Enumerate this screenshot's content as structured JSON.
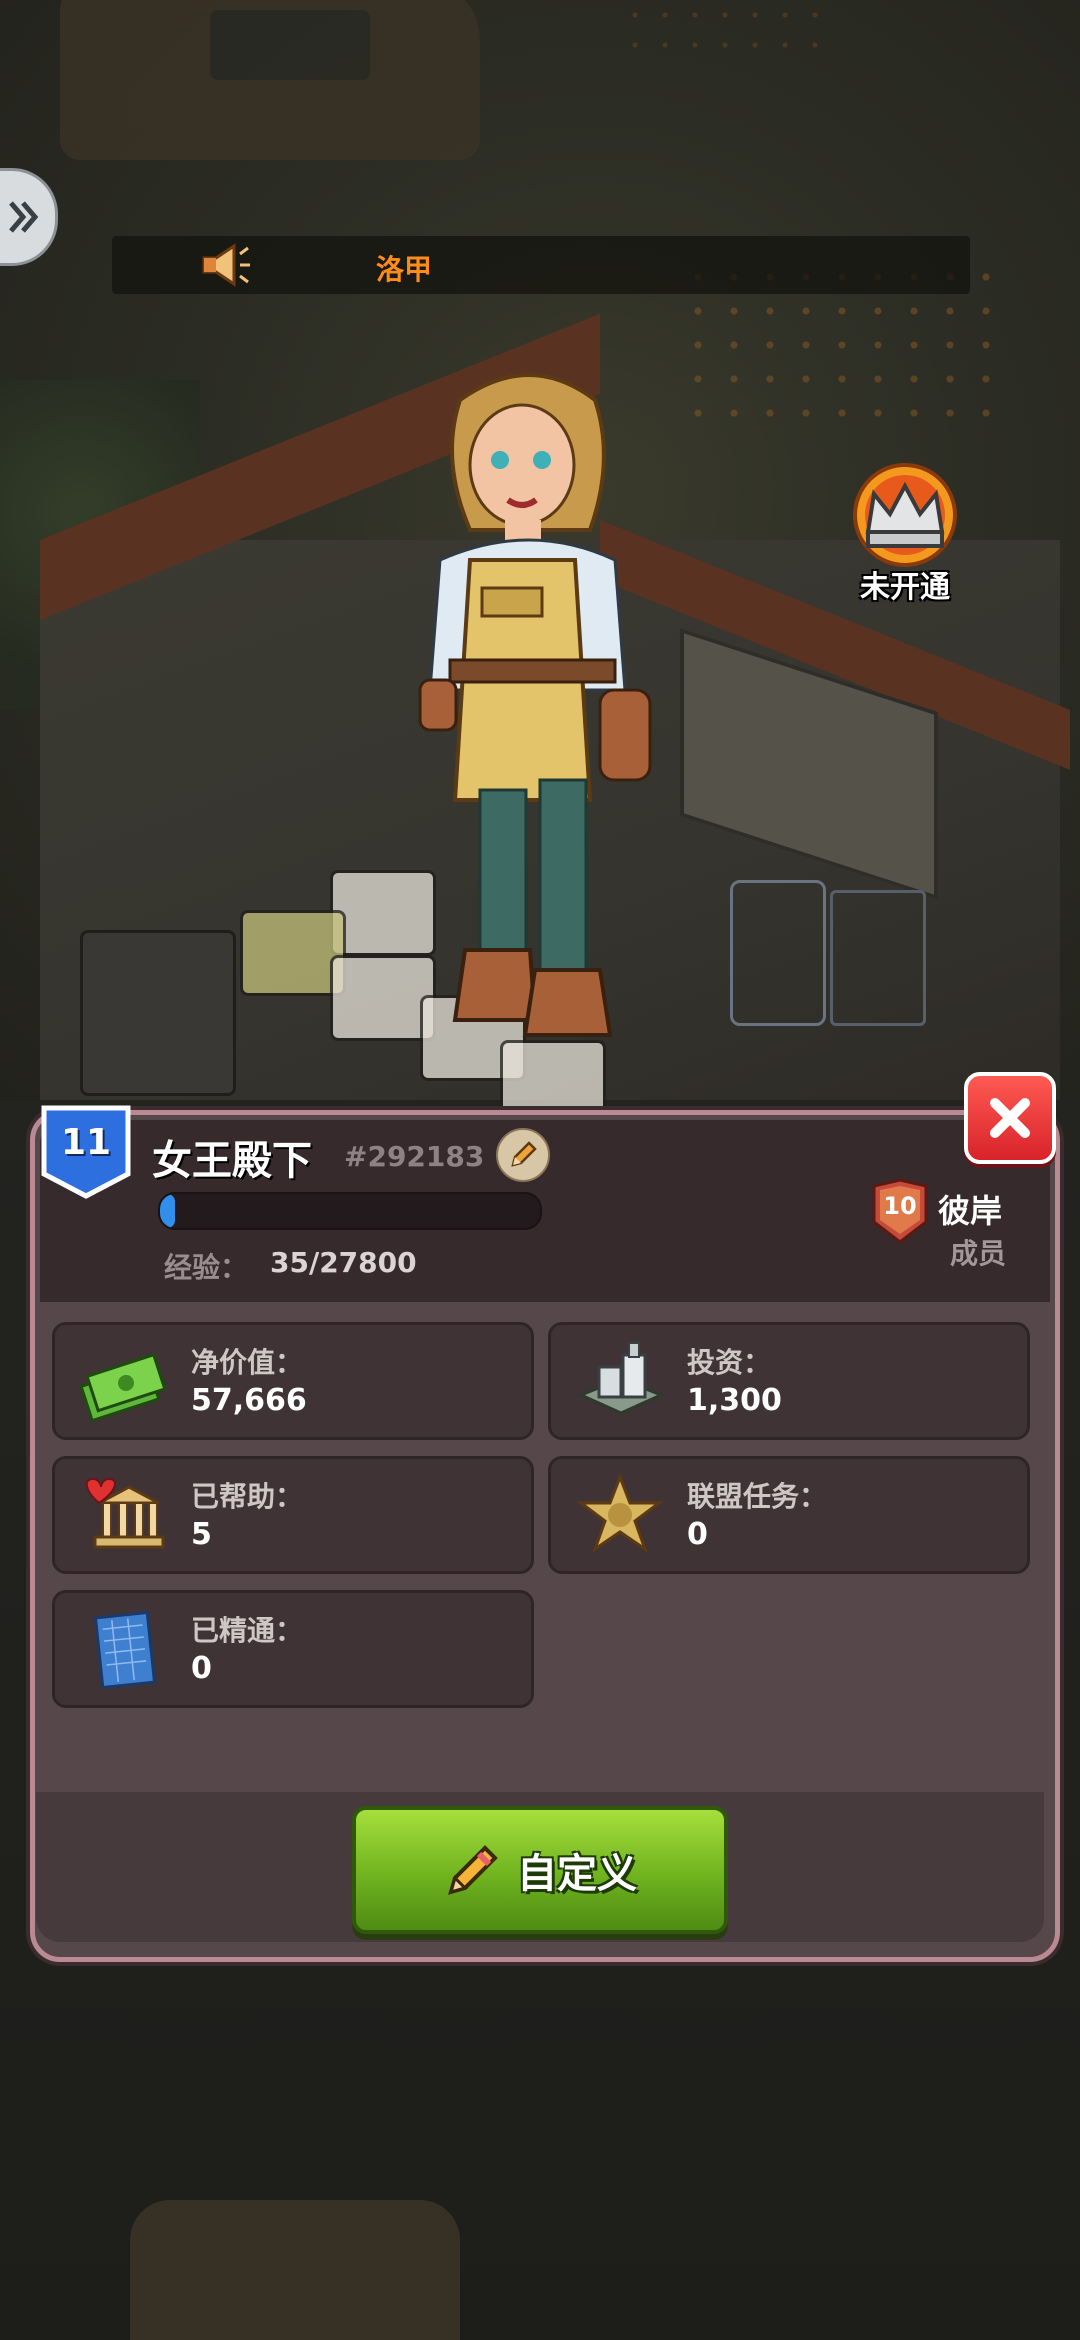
{
  "announcement": {
    "speaker_name": "洛甲"
  },
  "crown": {
    "status_label": "未开通"
  },
  "profile": {
    "level": "11",
    "name": "女王殿下",
    "player_id": "#292183",
    "xp_label": "经验：",
    "xp_value": "35/27800",
    "xp_progress": 0.00126,
    "alliance": {
      "rank": "10",
      "name": "彼岸",
      "role": "成员"
    }
  },
  "stats": {
    "net_worth": {
      "label": "净价值：",
      "value": "57,666",
      "icon": "cash-stack-icon"
    },
    "investment": {
      "label": "投资：",
      "value": "1,300",
      "icon": "building-icon"
    },
    "helped": {
      "label": "已帮助：",
      "value": "5",
      "icon": "heart-bank-icon"
    },
    "alliance_tasks": {
      "label": "联盟任务：",
      "value": "0",
      "icon": "sheriff-star-icon"
    },
    "mastered": {
      "label": "已精通：",
      "value": "0",
      "icon": "blueprint-icon"
    }
  },
  "actions": {
    "customize_label": "自定义"
  },
  "colors": {
    "accent_green": "#7bc22a",
    "close_red": "#e0302f",
    "xp_blue": "#2f8fea",
    "announce_orange": "#ff8c1a"
  }
}
